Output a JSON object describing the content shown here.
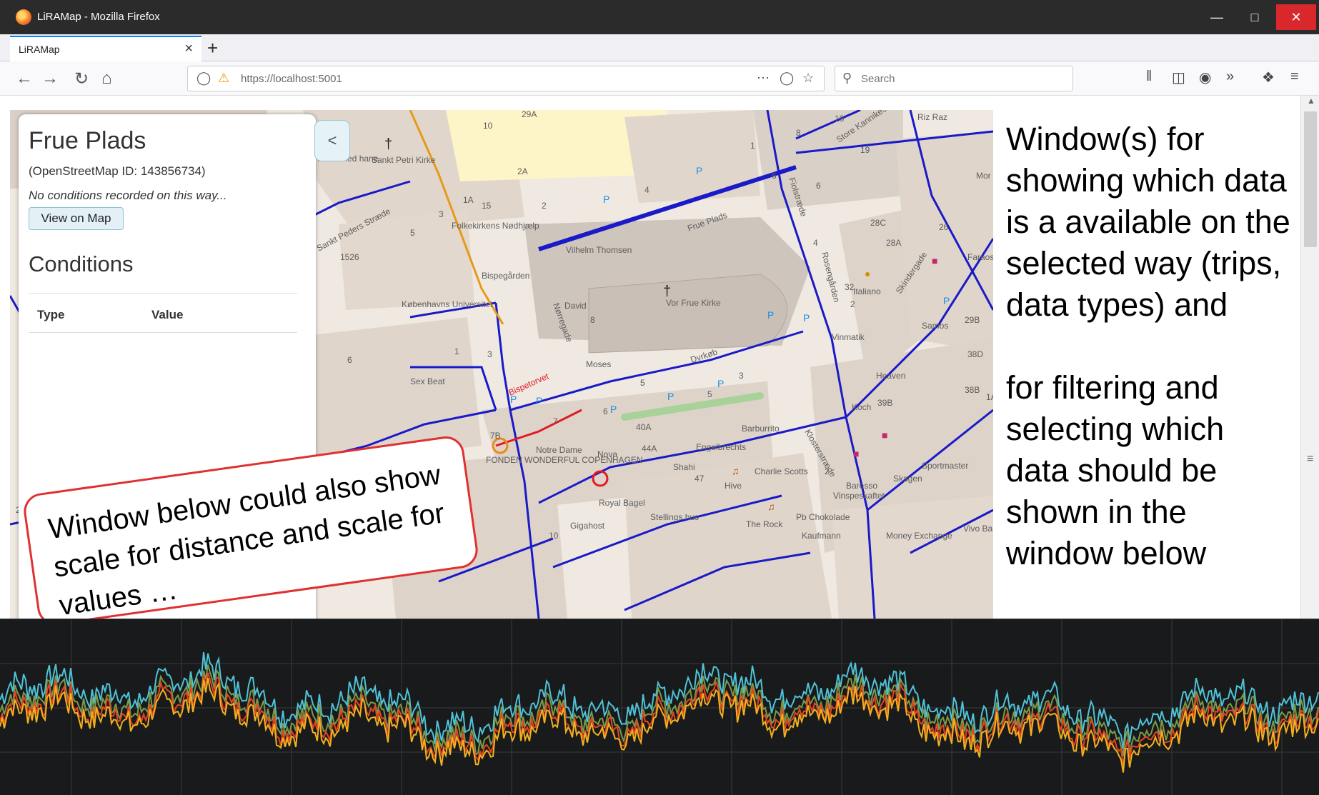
{
  "browser": {
    "window_title": "LiRAMap - Mozilla Firefox",
    "tab_label": "LiRAMap",
    "url": "https://localhost:5001",
    "search_placeholder": "Search",
    "window_controls": [
      "minimize",
      "maximize",
      "close"
    ],
    "nav_icons": [
      "back-icon",
      "forward-icon",
      "reload-icon",
      "home-icon"
    ],
    "toolbar_icons": [
      "library-icon",
      "sidebar-icon",
      "account-icon",
      "overflow-icon",
      "extensions-icon",
      "menu-icon"
    ],
    "accent_color": "#0a84ff"
  },
  "info_panel": {
    "way_name": "Frue Plads",
    "osm_id_text": "(OpenStreetMap ID: 143856734)",
    "no_conditions_text": "No conditions recorded on this way...",
    "view_on_map_label": "View on Map",
    "conditions_heading": "Conditions",
    "table_headers": {
      "type": "Type",
      "value": "Value"
    },
    "collapse_label": "<"
  },
  "map": {
    "labels": {
      "sankt_petri_kirke": "Sankt Petri Kirke",
      "peter_med_hane": "Peter med hane",
      "sankt_peders_straede": "Sankt Peders Stræde",
      "folkekirkens_nodhjaelp": "Folkekirkens Nødhjælp",
      "vilhelm_thomsen": "Vilhelm Thomsen",
      "bispegaarden": "Bispegården",
      "koebenhavns_universitet": "Københavns Universitet",
      "vor_frue_kirke": "Vor Frue Kirke",
      "david": "David",
      "moses": "Moses",
      "bispetorvet": "Bispetorvet",
      "noerregade": "Nørregade",
      "frue_plads": "Frue Plads",
      "dyrkoeb": "Dyrkøb",
      "fiolstraede": "Fiolstræde",
      "store_kannikestraede": "Store Kannikestræde",
      "sex_beat": "Sex Beat",
      "notre_dame": "Notre Dame",
      "fonden": "FONDEN WONDERFUL COPENHAGEN",
      "nova": "Nova",
      "shahi": "Shahi",
      "engelbrechts": "Engelbrechts",
      "barburrito": "Barburrito",
      "royal_bagel": "Royal Bagel",
      "hive": "Hive",
      "charlie_scotts": "Charlie Scotts",
      "stellings_hus": "Stellings hus",
      "the_rock": "The Rock",
      "pb_chokolade": "Pb Chokolade",
      "kaufmann": "Kaufmann",
      "baresso": "Baresso",
      "vinspeskaftet": "Vinspeskaftet",
      "skagen": "Skagen",
      "sportmaster": "Sportmaster",
      "money_exchange": "Money Exchange",
      "vivo_ba": "Vivo Ba",
      "koch": "Koch",
      "heaven": "Heaven",
      "italiano": "Italiano",
      "samos": "Samos",
      "vinmatik": "Vinmatik",
      "riz_raz": "Riz Raz",
      "gigahost": "Gigahost",
      "faraos_cigarer": "Faraos Cigarer",
      "mor": "Mor",
      "rosengaarden": "Rosengården",
      "skindergade": "Skindergade",
      "klosterstraede": "Klosterstræde"
    },
    "house_numbers": [
      "29A",
      "10",
      "2A",
      "18",
      "8",
      "19",
      "1",
      "4",
      "2",
      "6",
      "1A",
      "15",
      "3",
      "5",
      "7",
      "2",
      "4",
      "28C",
      "26",
      "28A",
      "1526",
      "8",
      "32",
      "29B",
      "38D",
      "38B",
      "39B",
      "40A",
      "44A",
      "47",
      "5",
      "6",
      "7",
      "7B",
      "3",
      "1",
      "6",
      "6",
      "1A",
      "4B",
      "2B",
      "10",
      "2",
      "3",
      "6",
      "5",
      "26"
    ],
    "road_color": "#1a1ac8",
    "selected_road_color": "#e01b24"
  },
  "side_note": {
    "text": "Window(s) for showing which data is a available on the selected way (trips, data types) and\n\nfor filtering and selecting which data should be shown in the window below"
  },
  "callout": {
    "text": "Window below could also show scale for distance and scale for values …",
    "border_color": "#e03030"
  },
  "graph": {
    "background": "#191a1c",
    "series": [
      {
        "color": "#4fc3d6"
      },
      {
        "color": "#7a9a48"
      },
      {
        "color": "#e54522"
      },
      {
        "color": "#f2b01e"
      }
    ]
  }
}
